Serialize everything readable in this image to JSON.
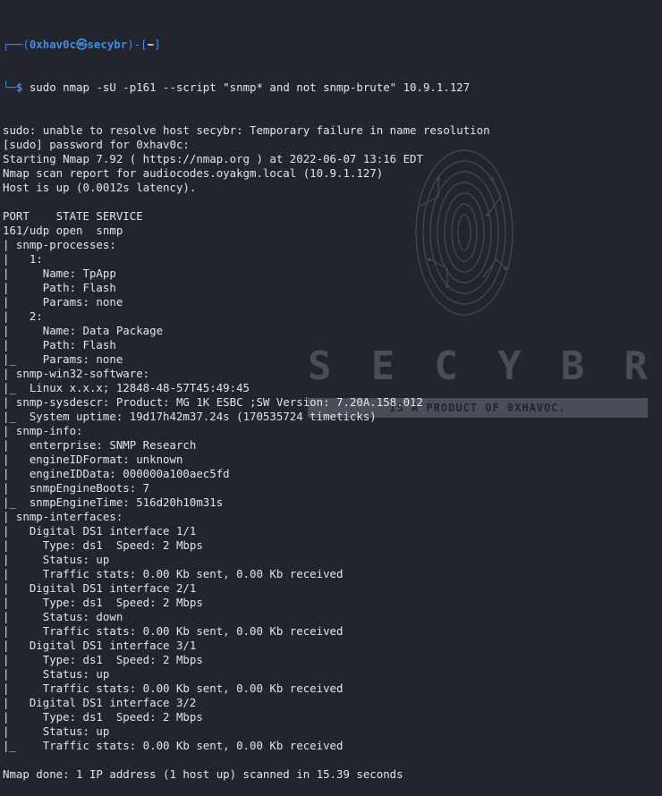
{
  "prompt": {
    "corner_top": "┌──(",
    "user_host_user": "0xhav0c",
    "at_glyph": "㉿",
    "host": "secybr",
    "bracket_mid": ")-[",
    "cwd": "~",
    "bracket_end": "]",
    "corner_bottom": "└─",
    "dollar": "$",
    "command": " sudo nmap -sU -p161 --script \"snmp* and not snmp-brute\" 10.9.1.127"
  },
  "output_lines": [
    "sudo: unable to resolve host secybr: Temporary failure in name resolution",
    "[sudo] password for 0xhav0c:",
    "Starting Nmap 7.92 ( https://nmap.org ) at 2022-06-07 13:16 EDT",
    "Nmap scan report for audiocodes.oyakgm.local (10.9.1.127)",
    "Host is up (0.0012s latency).",
    "",
    "PORT    STATE SERVICE",
    "161/udp open  snmp",
    "| snmp-processes:",
    "|   1:",
    "|     Name: TpApp",
    "|     Path: Flash",
    "|     Params: none",
    "|   2:",
    "|     Name: Data Package",
    "|     Path: Flash",
    "|_    Params: none",
    "| snmp-win32-software:",
    "|_  Linux x.x.x; 12848-48-57T45:49:45",
    "| snmp-sysdescr: Product: MG 1K ESBC ;SW Version: 7.20A.158.012",
    "|_  System uptime: 19d17h42m37.24s (170535724 timeticks)",
    "| snmp-info:",
    "|   enterprise: SNMP Research",
    "|   engineIDFormat: unknown",
    "|   engineIDData: 000000a100aec5fd",
    "|   snmpEngineBoots: 7",
    "|_  snmpEngineTime: 516d20h10m31s",
    "| snmp-interfaces:",
    "|   Digital DS1 interface 1/1",
    "|     Type: ds1  Speed: 2 Mbps",
    "|     Status: up",
    "|     Traffic stats: 0.00 Kb sent, 0.00 Kb received",
    "|   Digital DS1 interface 2/1",
    "|     Type: ds1  Speed: 2 Mbps",
    "|     Status: down",
    "|     Traffic stats: 0.00 Kb sent, 0.00 Kb received",
    "|   Digital DS1 interface 3/1",
    "|     Type: ds1  Speed: 2 Mbps",
    "|     Status: up",
    "|     Traffic stats: 0.00 Kb sent, 0.00 Kb received",
    "|   Digital DS1 interface 3/2",
    "|     Type: ds1  Speed: 2 Mbps",
    "|     Status: up",
    "|_    Traffic stats: 0.00 Kb sent, 0.00 Kb received",
    "",
    "Nmap done: 1 IP address (1 host up) scanned in 15.39 seconds"
  ],
  "watermark": {
    "letters": [
      "S",
      "E",
      "C",
      "Y",
      "B",
      "R"
    ],
    "tagline": "IS A PRODUCT OF 0XHAVOC."
  },
  "colors": {
    "background": "#23252e",
    "text": "#e4e4e6",
    "prompt_accent": "#3d8ee8"
  }
}
